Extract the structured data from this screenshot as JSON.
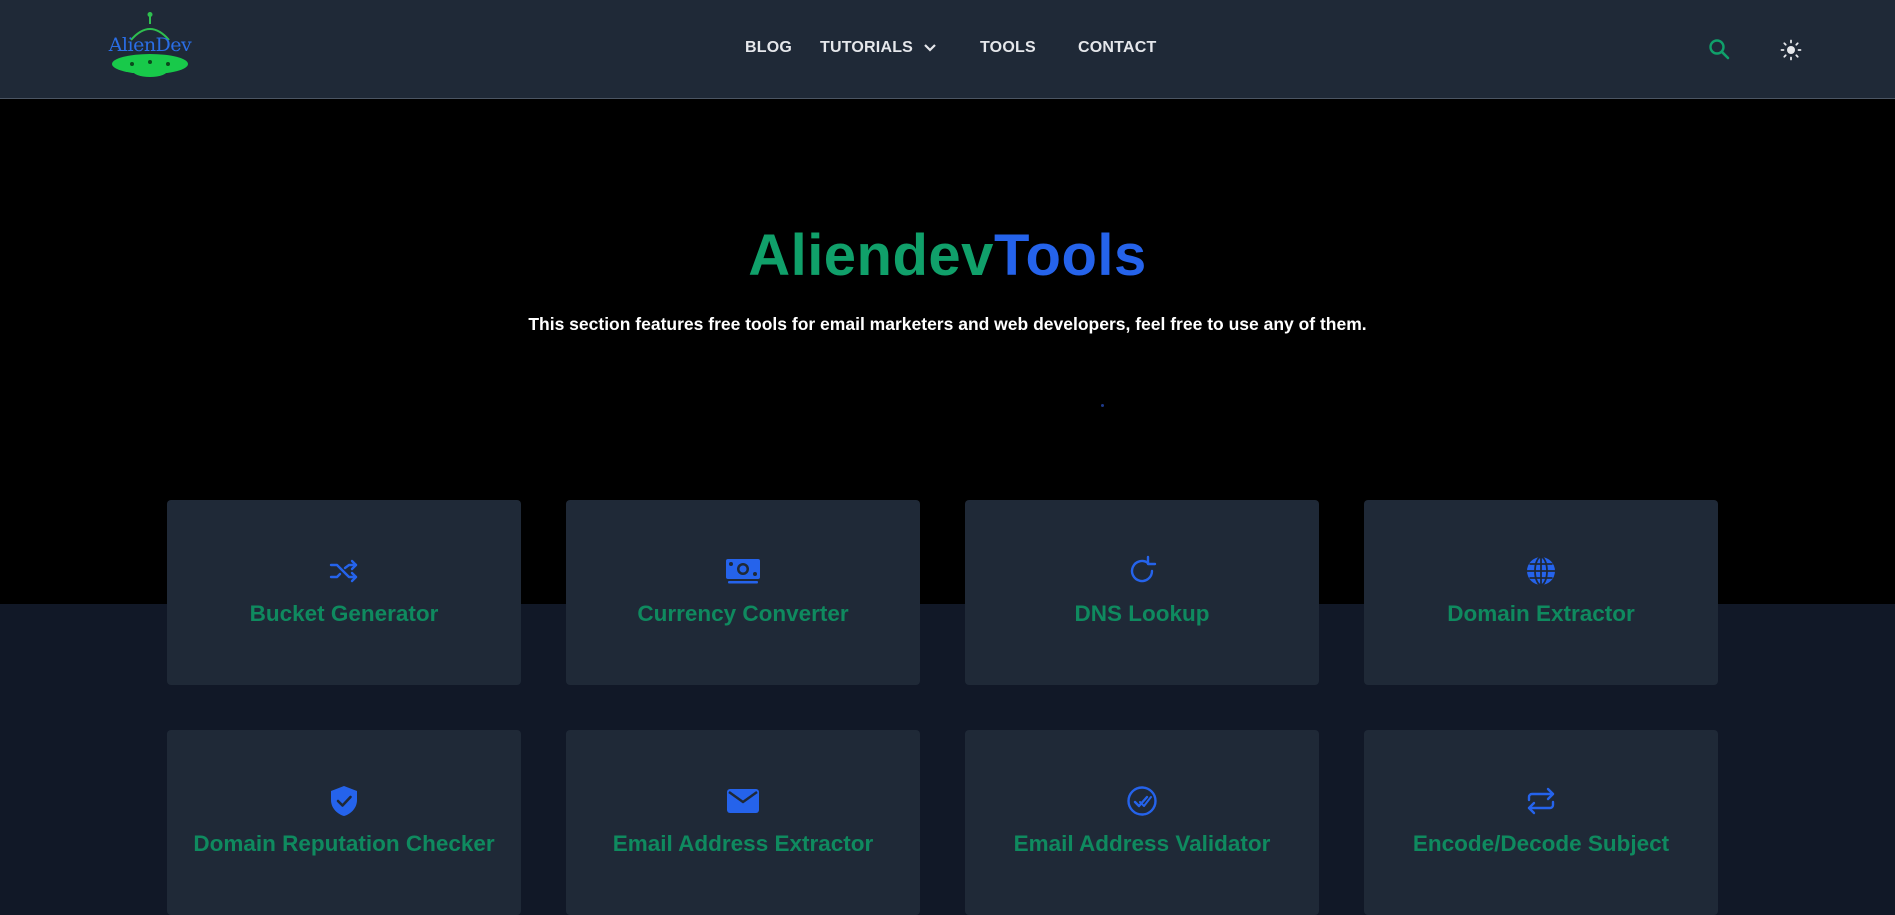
{
  "brand": {
    "logo_text": "AlienDev"
  },
  "nav": {
    "blog": "BLOG",
    "tutorials": "TUTORIALS",
    "tools": "TOOLS",
    "contact": "CONTACT"
  },
  "header_icons": {
    "search": "search-icon",
    "theme": "sun-icon"
  },
  "hero": {
    "title_part1": "Aliendev",
    "title_part2": "Tools",
    "subtitle": "This section features free tools for email marketers and web developers, feel free to use any of them."
  },
  "colors": {
    "accent_green": "#10a06a",
    "accent_blue": "#2563eb",
    "card_bg": "#1f2937",
    "page_bg": "#111827"
  },
  "tools": [
    {
      "label": "Bucket Generator",
      "icon": "shuffle-icon"
    },
    {
      "label": "Currency Converter",
      "icon": "banknote-icon"
    },
    {
      "label": "DNS Lookup",
      "icon": "refresh-icon"
    },
    {
      "label": "Domain Extractor",
      "icon": "globe-icon"
    },
    {
      "label": "Domain Reputation Checker",
      "icon": "shield-check-icon"
    },
    {
      "label": "Email Address Extractor",
      "icon": "envelope-icon"
    },
    {
      "label": "Email Address Validator",
      "icon": "check-circle-icon"
    },
    {
      "label": "Encode/Decode Subject",
      "icon": "repeat-icon"
    }
  ]
}
